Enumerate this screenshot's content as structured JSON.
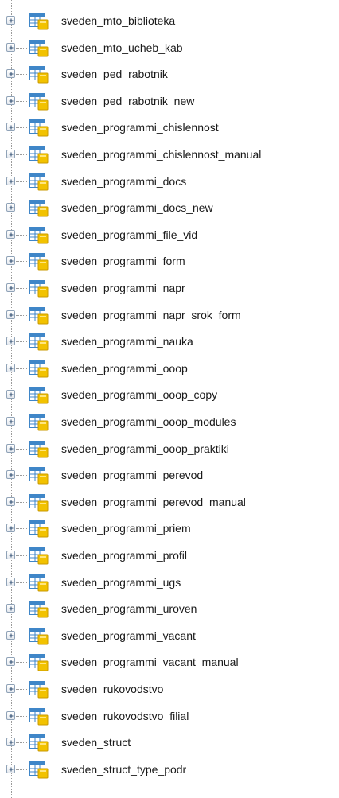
{
  "tree": {
    "items": [
      {
        "label": "sveden_mto_biblioteka",
        "icon": "table-icon"
      },
      {
        "label": "sveden_mto_ucheb_kab",
        "icon": "table-icon"
      },
      {
        "label": "sveden_ped_rabotnik",
        "icon": "table-icon"
      },
      {
        "label": "sveden_ped_rabotnik_new",
        "icon": "table-icon"
      },
      {
        "label": "sveden_programmi_chislennost",
        "icon": "table-icon"
      },
      {
        "label": "sveden_programmi_chislennost_manual",
        "icon": "table-icon"
      },
      {
        "label": "sveden_programmi_docs",
        "icon": "table-icon"
      },
      {
        "label": "sveden_programmi_docs_new",
        "icon": "table-icon"
      },
      {
        "label": "sveden_programmi_file_vid",
        "icon": "table-icon"
      },
      {
        "label": "sveden_programmi_form",
        "icon": "table-icon"
      },
      {
        "label": "sveden_programmi_napr",
        "icon": "table-icon"
      },
      {
        "label": "sveden_programmi_napr_srok_form",
        "icon": "table-icon"
      },
      {
        "label": "sveden_programmi_nauka",
        "icon": "table-icon"
      },
      {
        "label": "sveden_programmi_ooop",
        "icon": "table-icon"
      },
      {
        "label": "sveden_programmi_ooop_copy",
        "icon": "table-icon"
      },
      {
        "label": "sveden_programmi_ooop_modules",
        "icon": "table-icon"
      },
      {
        "label": "sveden_programmi_ooop_praktiki",
        "icon": "table-icon"
      },
      {
        "label": "sveden_programmi_perevod",
        "icon": "table-icon"
      },
      {
        "label": "sveden_programmi_perevod_manual",
        "icon": "table-icon"
      },
      {
        "label": "sveden_programmi_priem",
        "icon": "table-icon"
      },
      {
        "label": "sveden_programmi_profil",
        "icon": "table-icon"
      },
      {
        "label": "sveden_programmi_ugs",
        "icon": "table-icon"
      },
      {
        "label": "sveden_programmi_uroven",
        "icon": "table-icon"
      },
      {
        "label": "sveden_programmi_vacant",
        "icon": "table-icon"
      },
      {
        "label": "sveden_programmi_vacant_manual",
        "icon": "table-icon"
      },
      {
        "label": "sveden_rukovodstvo",
        "icon": "table-icon"
      },
      {
        "label": "sveden_rukovodstvo_filial",
        "icon": "table-icon"
      },
      {
        "label": "sveden_struct",
        "icon": "table-icon"
      },
      {
        "label": "sveden_struct_type_podr",
        "icon": "table-icon"
      }
    ],
    "expander_icon": "plus-expander-icon"
  },
  "colors": {
    "tree_line": "#9a9a9a",
    "expander_border": "#8fa2b7",
    "icon_blue": "#3f86c8",
    "icon_yellow": "#f2c200",
    "text": "#1a1a1a"
  }
}
